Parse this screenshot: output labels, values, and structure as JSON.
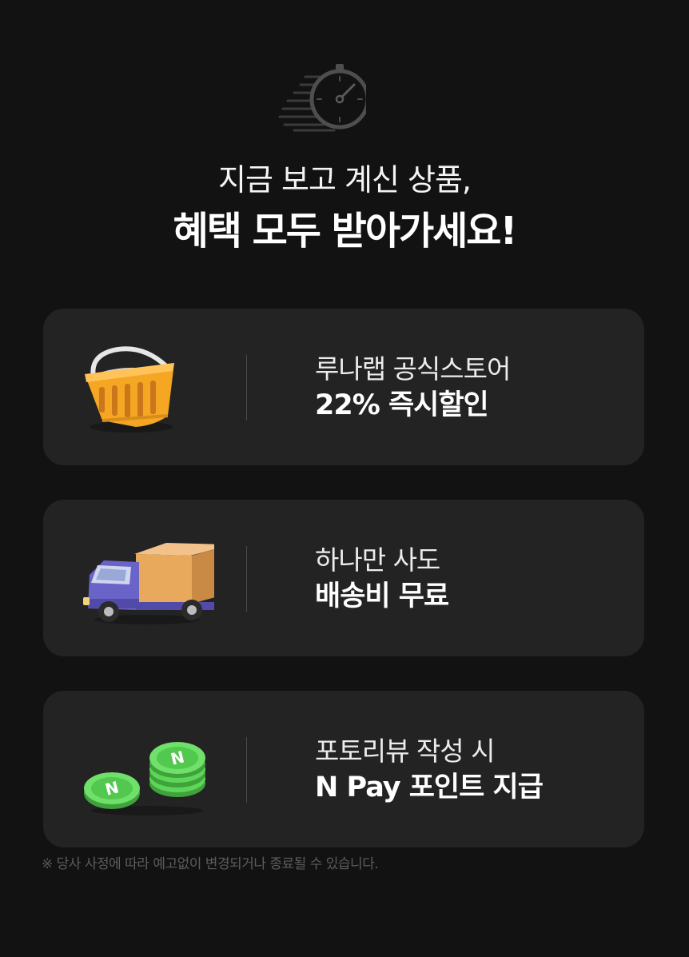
{
  "icons": {
    "header": "stopwatch-icon",
    "card1": "shopping-basket-icon",
    "card2": "delivery-truck-icon",
    "card3": "npay-coins-icon"
  },
  "colors": {
    "background": "#121212",
    "card": "#232323",
    "basket": "#f5a623",
    "truck_body": "#6a64c8",
    "truck_box": "#e8a95c",
    "coin": "#5ed65a"
  },
  "headline": {
    "line1": "지금 보고 계신 상품,",
    "line2": "혜택 모두 받아가세요!"
  },
  "benefits": [
    {
      "line1": "루나랩 공식스토어",
      "line2": "22% 즉시할인"
    },
    {
      "line1": "하나만 사도",
      "line2": "배송비 무료"
    },
    {
      "line1": "포토리뷰 작성 시",
      "line2": "N Pay 포인트 지급"
    }
  ],
  "coin_glyph": "N",
  "disclaimer": "※ 당사 사정에 따라 예고없이 변경되거나 종료될 수 있습니다."
}
